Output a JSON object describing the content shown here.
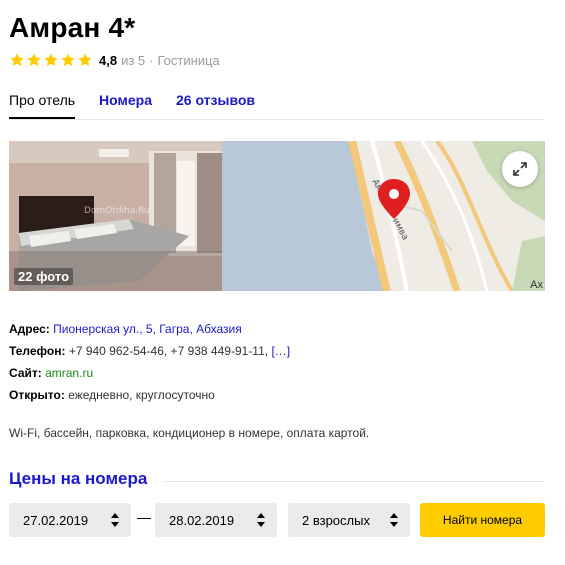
{
  "hotel": {
    "name": "Амран 4*",
    "rating_value": "4,8",
    "rating_scale": "из 5",
    "separator": "·",
    "category": "Гостиница",
    "stars": 5
  },
  "tabs": [
    {
      "label": "Про отель",
      "active": true
    },
    {
      "label": "Номера",
      "active": false
    },
    {
      "label": "26 отзывов",
      "active": false
    }
  ],
  "media": {
    "photo_watermark": "DomOtdiha.Ru",
    "photo_count": "22 фото",
    "map_corner_text": "Ах",
    "map_road_label": "Аминкоб имва",
    "expand_icon": "expand-arrows-icon"
  },
  "info": {
    "address_label": "Адрес:",
    "address_value": "Пионерская ул., 5, Гагра, Абхазия",
    "phone_label": "Телефон:",
    "phone_value": "+7 940 962-54-46, +7 938 449-91-11,",
    "phone_more": "[…]",
    "site_label": "Сайт:",
    "site_value": "amran.ru",
    "open_label": "Открыто:",
    "open_value": "ежедневно, круглосуточно"
  },
  "amenities": "Wi-Fi, бассейн, парковка, кондиционер в номере, оплата картой.",
  "prices": {
    "title": "Цены на номера",
    "checkin": "27.02.2019",
    "dash": "—",
    "checkout": "28.02.2019",
    "guests": "2 взрослых",
    "find_label": "Найти номера"
  },
  "colors": {
    "link": "#1a1acc",
    "star": "#ffcc00",
    "button": "#ffcc00",
    "site_link": "#1a8a1a"
  }
}
